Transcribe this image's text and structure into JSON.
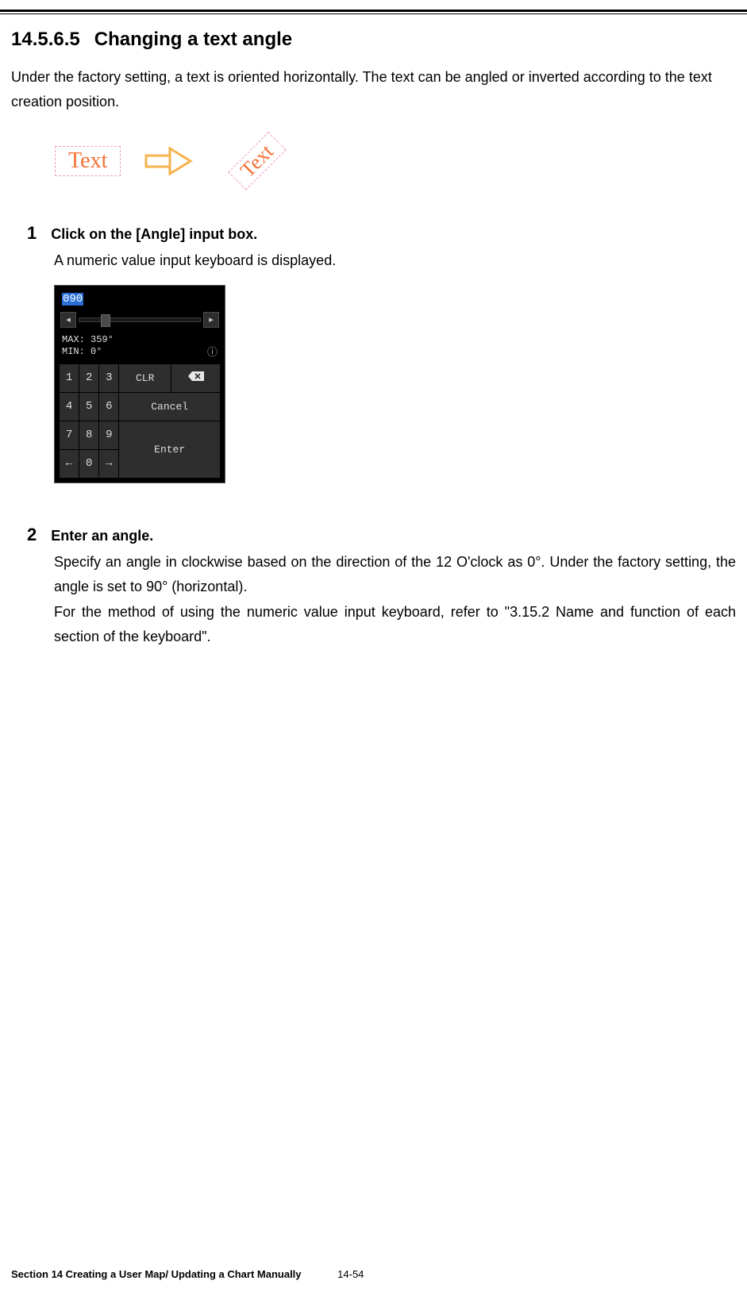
{
  "heading": {
    "number": "14.5.6.5",
    "title": "Changing a text angle"
  },
  "intro": "Under the factory setting, a text is oriented horizontally. The text can be angled or inverted according to the text creation position.",
  "illustration": {
    "horiz_text": "Text",
    "rotated_text": "Text"
  },
  "step1": {
    "num": "1",
    "title": "Click on the [Angle] input box.",
    "body": "A numeric value input keyboard is displayed."
  },
  "keypad": {
    "input_value": "090",
    "slider_left_glyph": "◂",
    "slider_right_glyph": "▸",
    "max_label": "MAX: 359°",
    "min_label": "MIN: 0°",
    "info_glyph": "ⓘ",
    "keys": {
      "k1": "1",
      "k2": "2",
      "k3": "3",
      "clr": "CLR",
      "k4": "4",
      "k5": "5",
      "k6": "6",
      "cancel": "Cancel",
      "k7": "7",
      "k8": "8",
      "k9": "9",
      "kleft": "←",
      "k0": "0",
      "kright": "→",
      "enter": "Enter"
    }
  },
  "step2": {
    "num": "2",
    "title": "Enter an angle.",
    "body1": "Specify an angle in clockwise based on the direction of the 12 O'clock as 0°. Under the factory setting, the angle is set to 90° (horizontal).",
    "body2": "For the method of using the numeric value input keyboard, refer to \"3.15.2 Name and function of each section of the keyboard\"."
  },
  "footer": {
    "left": "Section 14    Creating a User Map/ Updating a Chart Manually",
    "page": "14-54"
  }
}
